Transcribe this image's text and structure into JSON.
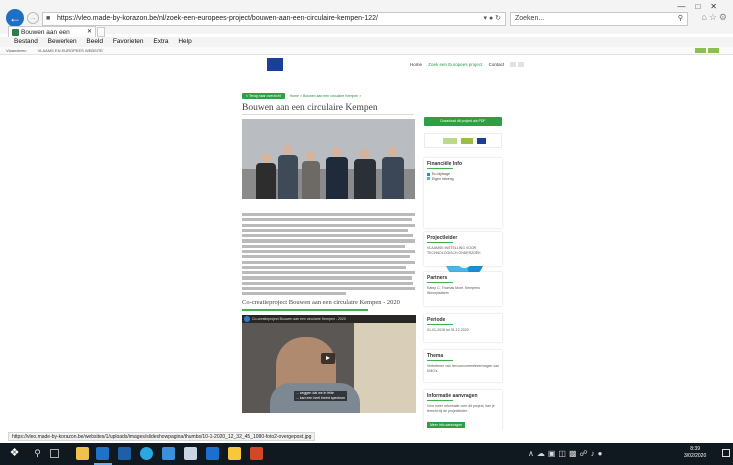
{
  "browser": {
    "url": "https://vleo.made-by-korazon.be/nl/zoek-een-europees-project/bouwen-aan-een-circulaire-kempen-122/",
    "search_placeholder": "Zoeken...",
    "tab_title": "Bouwen aan een circulaire ...",
    "menu": [
      "Bestand",
      "Bewerken",
      "Beeld",
      "Favorieten",
      "Extra",
      "Help"
    ],
    "favorites": [
      "Vlaanderen",
      "VLAAMS EN EUROPEES WEBSITE"
    ],
    "status_url": "https://vleo.made-by-korazon.be/websites/1/uploads/images/slideshowpagina/thumbs/10-1-2020_12_32_45_1080-foto2-overgepost.jpg"
  },
  "site": {
    "nav": {
      "home": "Home",
      "search": "Zoek een Europees project",
      "contact": "Contact"
    },
    "breadcrumb": {
      "back_label": "< Terug naar overzicht",
      "trail": "Home > Bouwen aan een circulaire Kempen >"
    },
    "page_title": "Bouwen aan een circulaire Kempen",
    "video_heading": "Co-creatieproject Bouwen aan een circulaire Kempen - 2020",
    "video": {
      "bar_title": "Co-creatieproject Bouwen aan een circulaire Kempen - 2020",
      "subtitle_line1": "... zeggen dat we in feite",
      "subtitle_line2": "... kan een heel breed spectrum"
    }
  },
  "sidebar": {
    "download_label": "Download dit project als PDF",
    "finance": {
      "heading": "Financiële Info",
      "legend": [
        "Eu-bijdrage",
        "Eigen inbreng"
      ]
    },
    "partners": {
      "heading": "Projectleider",
      "text": "VLAAMSE INSTELLING VOOR TECHNOLOGISCH ONDERZOEK"
    },
    "partners2": {
      "heading": "Partners",
      "text": "Kamp C, Thomas More, Kempens Woonplatform"
    },
    "period": {
      "heading": "Periode",
      "text": "01-01-2018 tot 31-12-2020"
    },
    "thema": {
      "heading": "Thema",
      "text": "Verbeteren van het concurrentievermogen van KMO's"
    },
    "more": {
      "heading": "Informatie aanvragen",
      "text": "Voor meer informatie over dit project, kan je terecht bij de projectleider.",
      "button": "Meer info aanvragen"
    }
  },
  "chart_data": {
    "type": "pie",
    "categories": [
      "Eu-bijdrage",
      "Eigen inbreng"
    ],
    "values": [
      45,
      55
    ],
    "colors": [
      "#1a8fd8",
      "#45b9ec"
    ]
  },
  "taskbar": {
    "time": "8:39",
    "date": "3/02/2020"
  }
}
